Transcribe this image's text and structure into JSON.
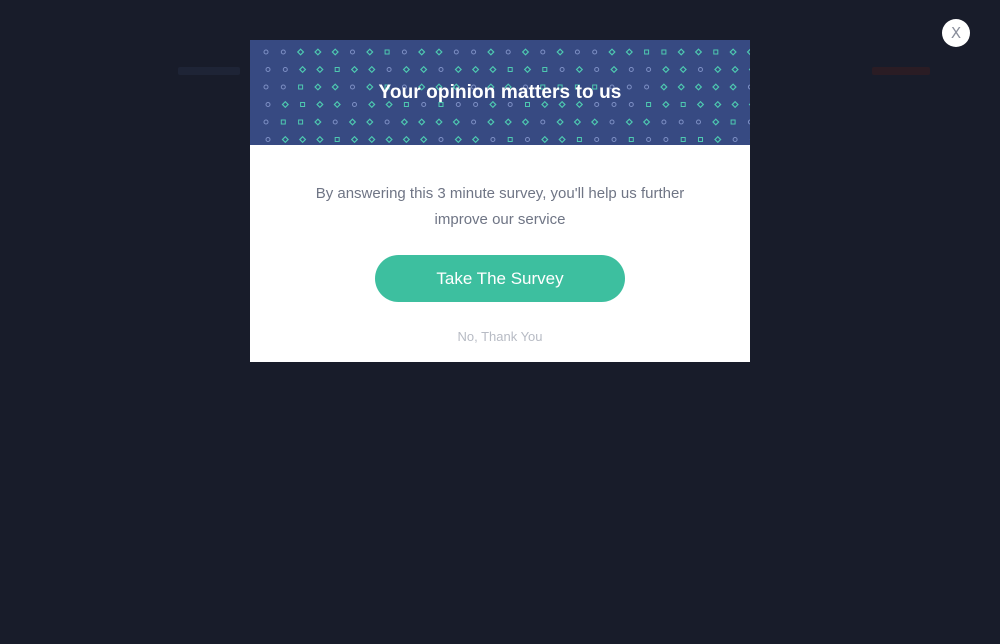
{
  "popup": {
    "title": "Your opinion matters to us",
    "message": "By answering this 3 minute survey, you'll help us further improve our service",
    "primary_button": "Take The Survey",
    "secondary_link": "No, Thank You",
    "close_label": "X"
  },
  "colors": {
    "page_background": "#181c2a",
    "header_background": "#374a82",
    "accent": "#3dbf9f",
    "pattern_square": "#4ec9b0",
    "pattern_circle": "#7d8fc4"
  }
}
